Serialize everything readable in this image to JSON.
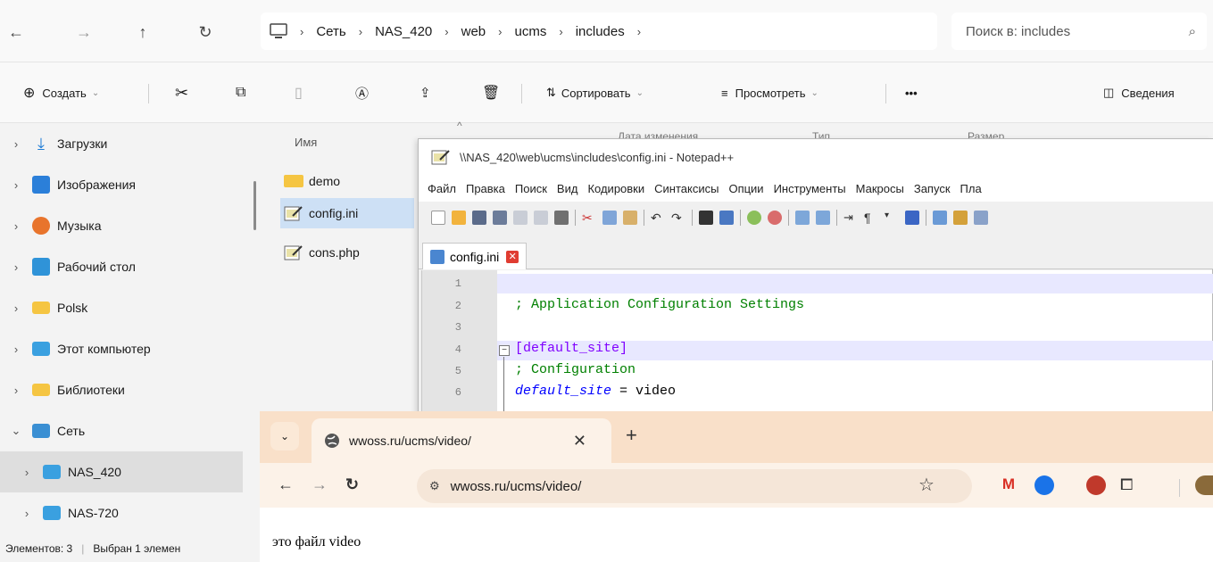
{
  "explorer": {
    "breadcrumb": [
      "Сеть",
      "NAS_420",
      "web",
      "ucms",
      "includes"
    ],
    "search_placeholder": "Поиск в: includes",
    "cmd": {
      "create": "Создать",
      "sort": "Сортировать",
      "view": "Просмотреть",
      "more": "•••",
      "details": "Сведения"
    },
    "sidebar": [
      {
        "label": "Загрузки",
        "icon": "download-icon"
      },
      {
        "label": "Изображения",
        "icon": "pictures-icon"
      },
      {
        "label": "Музыка",
        "icon": "music-icon"
      },
      {
        "label": "Рабочий стол",
        "icon": "desktop-icon"
      },
      {
        "label": "Polsk",
        "icon": "folder-icon"
      },
      {
        "label": "Этот компьютер",
        "icon": "computer-icon"
      },
      {
        "label": "Библиотеки",
        "icon": "libraries-icon"
      },
      {
        "label": "Сеть",
        "icon": "network-icon"
      },
      {
        "label": "NAS_420",
        "icon": "monitor-icon"
      },
      {
        "label": "NAS-720",
        "icon": "monitor-icon"
      }
    ],
    "columns": {
      "name": "Имя",
      "date": "Дата изменения",
      "type": "Тип",
      "size": "Размер"
    },
    "files": [
      {
        "name": "demo",
        "icon": "folder-icon"
      },
      {
        "name": "config.ini",
        "icon": "notepad-file-icon"
      },
      {
        "name": "cons.php",
        "icon": "notepad-file-icon"
      }
    ],
    "status": {
      "count": "Элементов: 3",
      "selected": "Выбран 1 элемен"
    }
  },
  "notepad": {
    "title": "\\\\NAS_420\\web\\ucms\\includes\\config.ini - Notepad++",
    "menu": [
      "Файл",
      "Правка",
      "Поиск",
      "Вид",
      "Кодировки",
      "Синтаксисы",
      "Опции",
      "Инструменты",
      "Макросы",
      "Запуск",
      "Пла"
    ],
    "tab": "config.ini",
    "lines": {
      "n1": "1",
      "n2": "2",
      "n3": "3",
      "n4": "4",
      "n5": "5",
      "n6": "6",
      "l2": "; Application Configuration Settings",
      "l4": "[default_site]",
      "l5": "; Configuration",
      "l6_key": "default_site",
      "l6_eq": " = ",
      "l6_val": "video"
    }
  },
  "chrome": {
    "tab_title": "wwoss.ru/ucms/video/",
    "url": "wwoss.ru/ucms/video/",
    "page_text": "это файл video",
    "colors": {
      "frame": "#f9e0c9",
      "toolbar": "#fcf2e8"
    }
  }
}
